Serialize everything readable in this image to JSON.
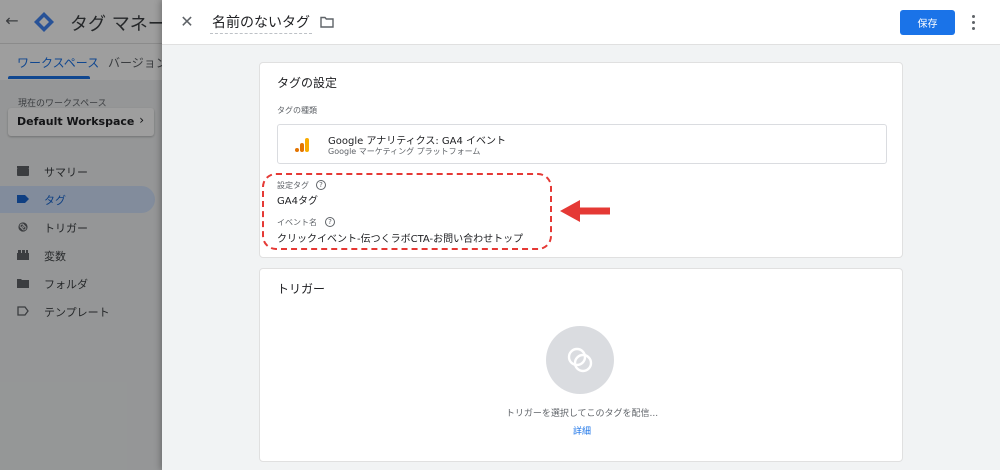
{
  "background": {
    "app_title": "タグ マネージャー",
    "tabs": [
      {
        "label": "ワークスペース",
        "active": true
      },
      {
        "label": "バージョン",
        "active": false
      }
    ],
    "workspace_label": "現在のワークスペース",
    "workspace_name": "Default Workspace",
    "nav": [
      {
        "label": "サマリー",
        "icon": "summary-icon",
        "active": false
      },
      {
        "label": "タグ",
        "icon": "tag-icon",
        "active": true
      },
      {
        "label": "トリガー",
        "icon": "trigger-icon",
        "active": false
      },
      {
        "label": "変数",
        "icon": "variable-icon",
        "active": false
      },
      {
        "label": "フォルダ",
        "icon": "folder-icon",
        "active": false
      },
      {
        "label": "テンプレート",
        "icon": "template-icon",
        "active": false
      }
    ]
  },
  "panel": {
    "tag_name": "名前のないタグ",
    "save_label": "保存",
    "config": {
      "title": "タグの設定",
      "type_label": "タグの種類",
      "type_name": "Google アナリティクス: GA4 イベント",
      "type_sub": "Google マーケティング プラットフォーム",
      "config_tag_label": "設定タグ",
      "config_tag_value": "GA4タグ",
      "event_name_label": "イベント名",
      "event_name_value": "クリックイベント-伝つくラボCTA-お問い合わせトップ"
    },
    "trigger": {
      "title": "トリガー",
      "prompt": "トリガーを選択してこのタグを配信...",
      "link": "詳細"
    }
  },
  "colors": {
    "primary": "#1a73e8",
    "annotation": "#e53935",
    "ga_orange": "#f9ab00",
    "ga_dark": "#e37400"
  }
}
